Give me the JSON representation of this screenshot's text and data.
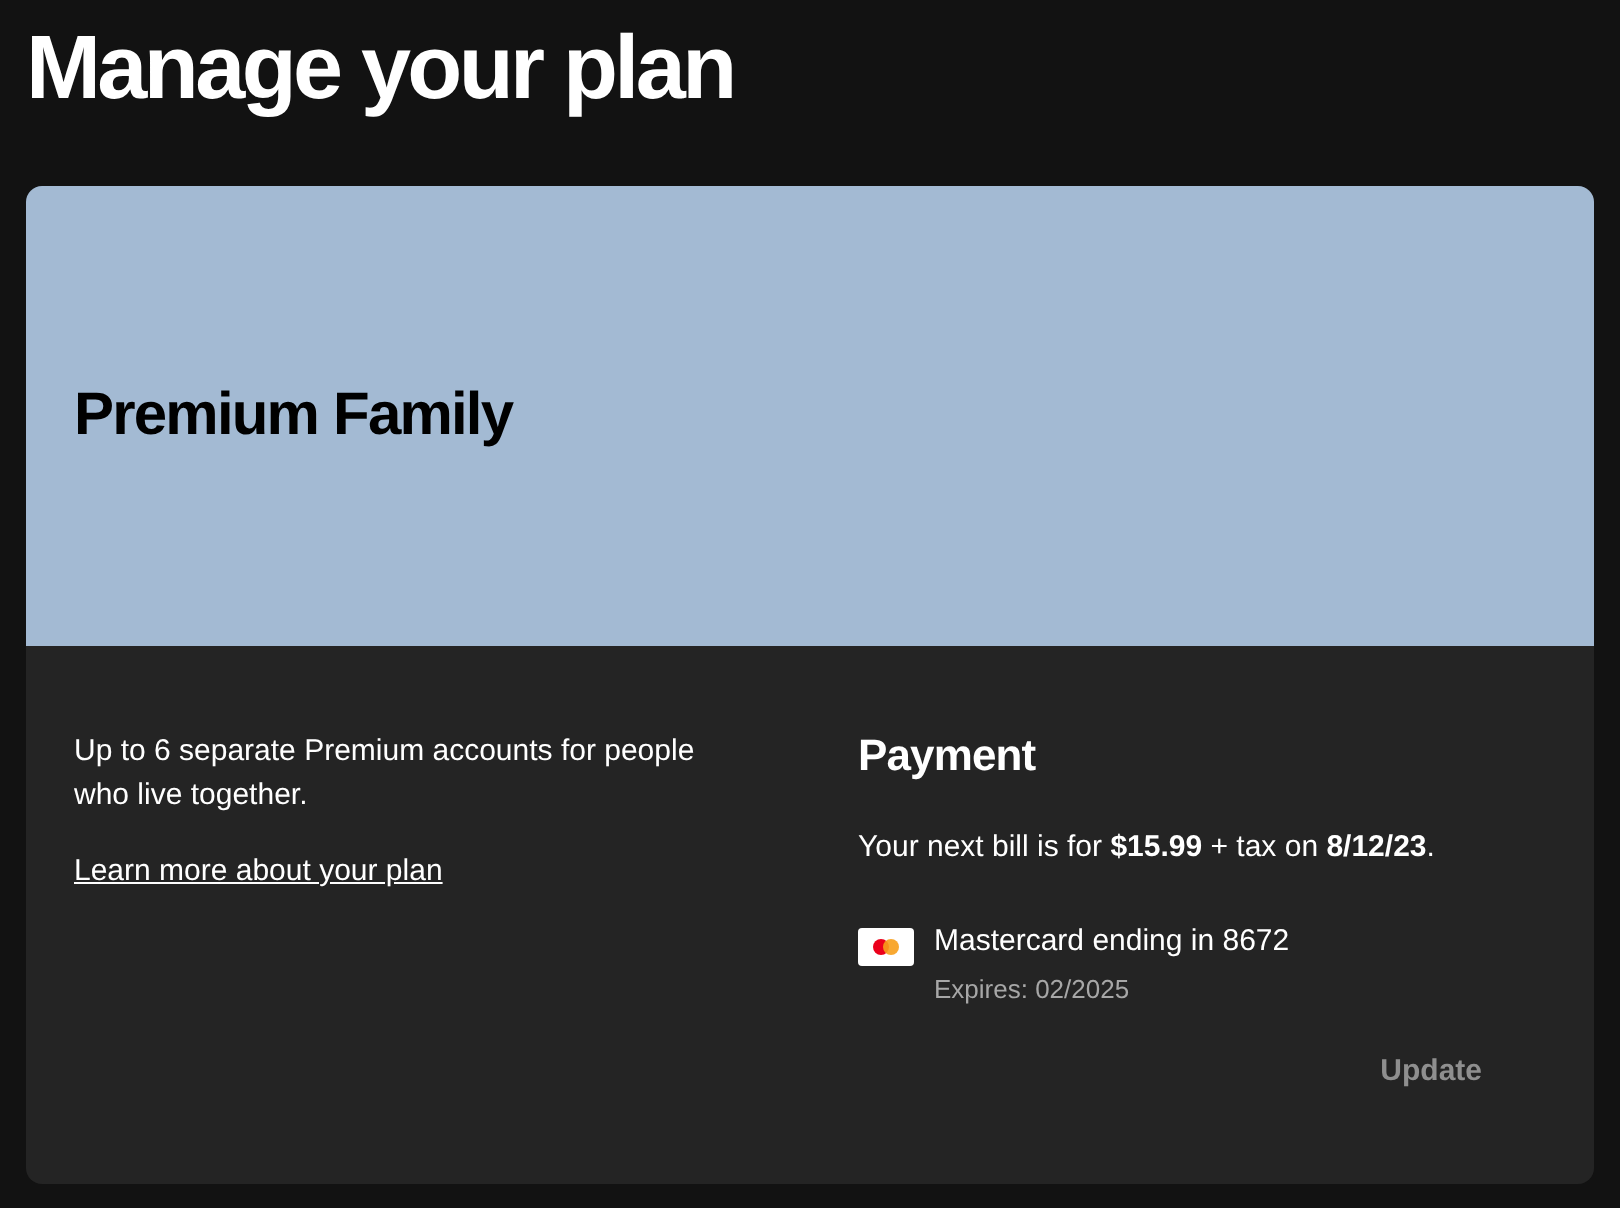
{
  "page": {
    "title": "Manage your plan"
  },
  "plan": {
    "name": "Premium Family",
    "description": "Up to 6 separate Premium accounts for people who live together.",
    "link": "Learn more about your plan"
  },
  "payment": {
    "title": "Payment",
    "bill": "Your next bill is for **$15.99** + tax on **8/12/23**.",
    "card": {
      "label": "Mastercard ending in 8672",
      "expires": "Expires: 02/2025"
    },
    "update_button": {
      "label": "Update",
      "disabled": true
    }
  }
}
